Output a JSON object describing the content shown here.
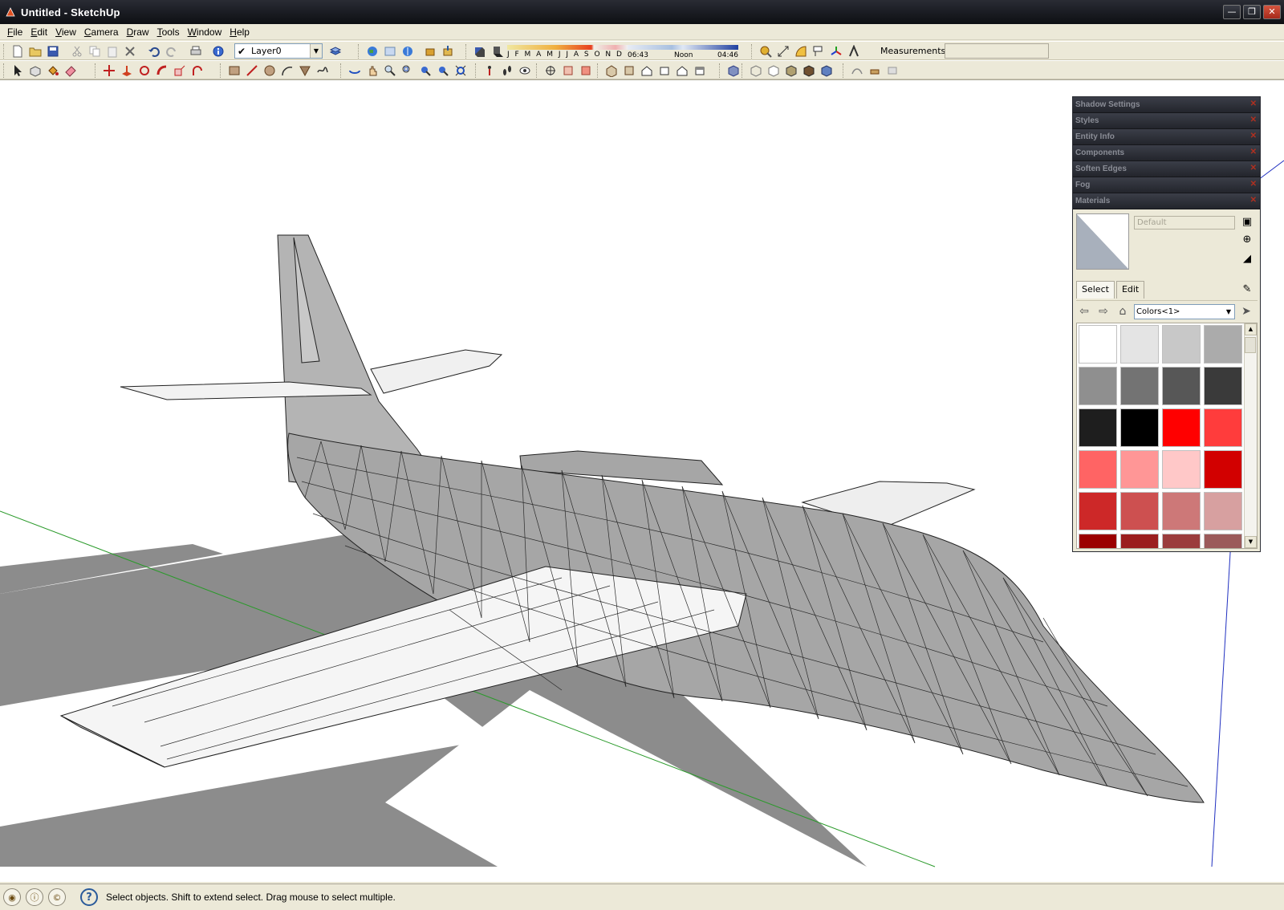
{
  "window": {
    "title": "Untitled - SketchUp",
    "controls": [
      "minimize",
      "restore",
      "close"
    ]
  },
  "menu": [
    "File",
    "Edit",
    "View",
    "Camera",
    "Draw",
    "Tools",
    "Window",
    "Help"
  ],
  "toolbar": {
    "layer": {
      "checked": true,
      "value": "Layer0"
    },
    "shadow": {
      "months": "J F M A M J J A S O N D",
      "time_start": "06:43",
      "time_noon": "Noon",
      "time_end": "04:46"
    },
    "measurements_label": "Measurements",
    "measurements_value": ""
  },
  "tray": {
    "panels": [
      "Shadow Settings",
      "Styles",
      "Entity Info",
      "Components",
      "Soften Edges",
      "Fog",
      "Materials"
    ],
    "materials": {
      "name_placeholder": "Default",
      "tabs": [
        "Select",
        "Edit"
      ],
      "active_tab": "Select",
      "collection": "Colors<1>",
      "swatches": [
        "#ffffff",
        "#e4e4e4",
        "#c8c8c8",
        "#ababab",
        "#8f8f8f",
        "#737373",
        "#575757",
        "#3a3a3a",
        "#1e1e1e",
        "#000000",
        "#ff0000",
        "#ff3c3c",
        "#ff6464",
        "#ff9696",
        "#ffc8c8",
        "#d20000",
        "#cd2828",
        "#cd5050",
        "#cd7878",
        "#d7a0a0",
        "#9b0000",
        "#9b1e1e",
        "#9b3c3c",
        "#9b5a5a"
      ]
    }
  },
  "status": {
    "text": "Select objects. Shift to extend select. Drag mouse to select multiple."
  },
  "colors": {
    "accent_blue": "#2040a0",
    "axis_green": "#2a9a2a",
    "axis_blue": "#2030c0",
    "shadow": "#8c8c8c",
    "model_gray": "#a6a6a6"
  }
}
